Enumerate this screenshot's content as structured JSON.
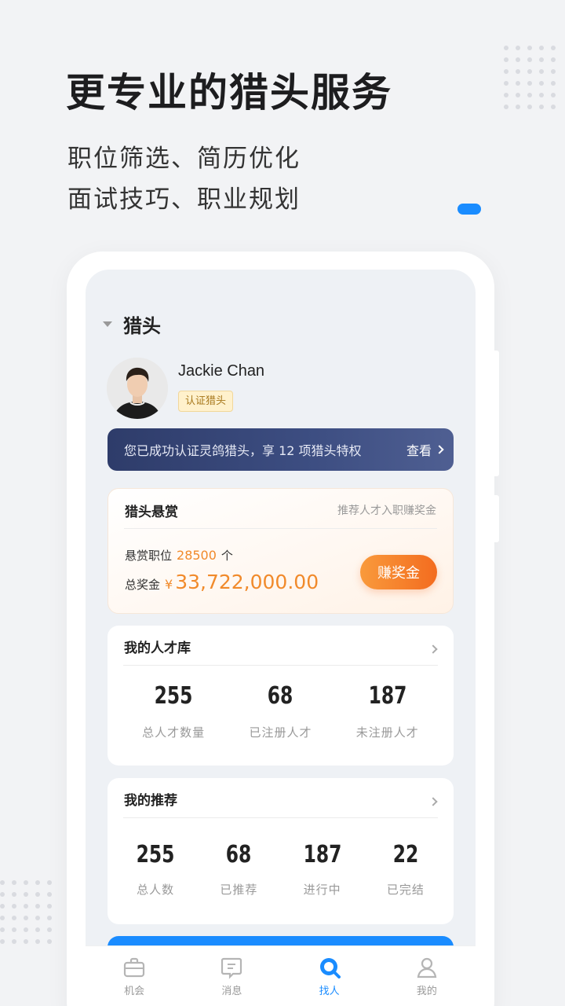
{
  "hero": {
    "title": "更专业的猎头服务",
    "subtitle_line1": "职位筛选、简历优化",
    "subtitle_line2": "面试技巧、职业规划"
  },
  "colors": {
    "accent": "#1a8cff",
    "reward_orange": "#f18a2b",
    "banner_navy": "#2e3c6a",
    "badge_gold": "#a7771b"
  },
  "section": {
    "title": "猎头"
  },
  "profile": {
    "name": "Jackie Chan",
    "badge": "认证猎头",
    "avatar_icon": "person-avatar"
  },
  "banner": {
    "text": "您已成功认证灵鸽猎头，享 12 项猎头特权",
    "link": "查看"
  },
  "reward": {
    "title": "猎头悬赏",
    "hint": "推荐人才入职赚奖金",
    "positions_label": "悬赏职位",
    "positions_value": "28500",
    "positions_unit": "个",
    "total_label": "总奖金",
    "currency": "¥",
    "total_value": "33,722,000.00",
    "button": "赚奖金"
  },
  "talent_pool": {
    "title": "我的人才库",
    "stats": [
      {
        "value": "255",
        "label": "总人才数量"
      },
      {
        "value": "68",
        "label": "已注册人才"
      },
      {
        "value": "187",
        "label": "未注册人才"
      }
    ]
  },
  "recommend": {
    "title": "我的推荐",
    "stats": [
      {
        "value": "255",
        "label": "总人数"
      },
      {
        "value": "68",
        "label": "已推荐"
      },
      {
        "value": "187",
        "label": "进行中"
      },
      {
        "value": "22",
        "label": "已完结"
      }
    ]
  },
  "tabbar": {
    "items": [
      {
        "label": "机会",
        "icon": "briefcase-icon",
        "active": false
      },
      {
        "label": "消息",
        "icon": "message-icon",
        "active": false
      },
      {
        "label": "找人",
        "icon": "search-person-icon",
        "active": true
      },
      {
        "label": "我的",
        "icon": "profile-icon",
        "active": false
      }
    ]
  }
}
